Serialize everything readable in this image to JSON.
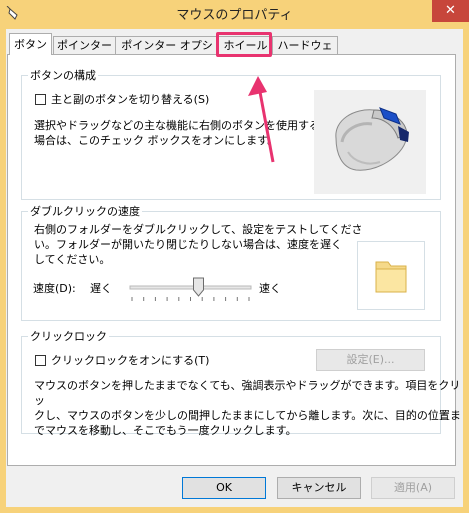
{
  "window": {
    "title": "マウスのプロパティ",
    "close_glyph": "✕"
  },
  "tabs": [
    {
      "label": "ボタン",
      "active": true
    },
    {
      "label": "ポインター",
      "active": false
    },
    {
      "label": "ポインター オプション",
      "active": false
    },
    {
      "label": "ホイール",
      "active": false
    },
    {
      "label": "ハードウェア",
      "active": false
    }
  ],
  "button_config": {
    "title": "ボタンの構成",
    "switch_label": "主と副のボタンを切り替える(S)",
    "switch_checked": false,
    "description_lines": [
      "選択やドラッグなどの主な機能に右側のボタンを使用する",
      "場合は、このチェック ボックスをオンにします。"
    ]
  },
  "double_click": {
    "title": "ダブルクリックの速度",
    "description_lines": [
      "右側のフォルダーをダブルクリックして、設定をテストしてくださ",
      "い。フォルダーが開いたり閉じたりしない場合は、速度を遅く",
      "してください。"
    ],
    "speed_label": "速度(D):",
    "slow_label": "遅く",
    "fast_label": "速く",
    "speed_level": 0.5
  },
  "click_lock": {
    "title": "クリックロック",
    "enable_label": "クリックロックをオンにする(T)",
    "enable_checked": false,
    "settings_button": "設定(E)...",
    "description_lines": [
      "マウスのボタンを押したままでなくても、強調表示やドラッグができます。項目をクリッ",
      "クし、マウスのボタンを少しの間押したままにしてから離します。次に、目的の位置ま",
      "でマウスを移動し、そこでもう一度クリックします。"
    ]
  },
  "footer": {
    "ok": "OK",
    "cancel": "キャンセル",
    "apply": "適用(A)"
  },
  "annotation": {
    "color": "#e8336f",
    "highlighted_tab": "ホイール"
  }
}
